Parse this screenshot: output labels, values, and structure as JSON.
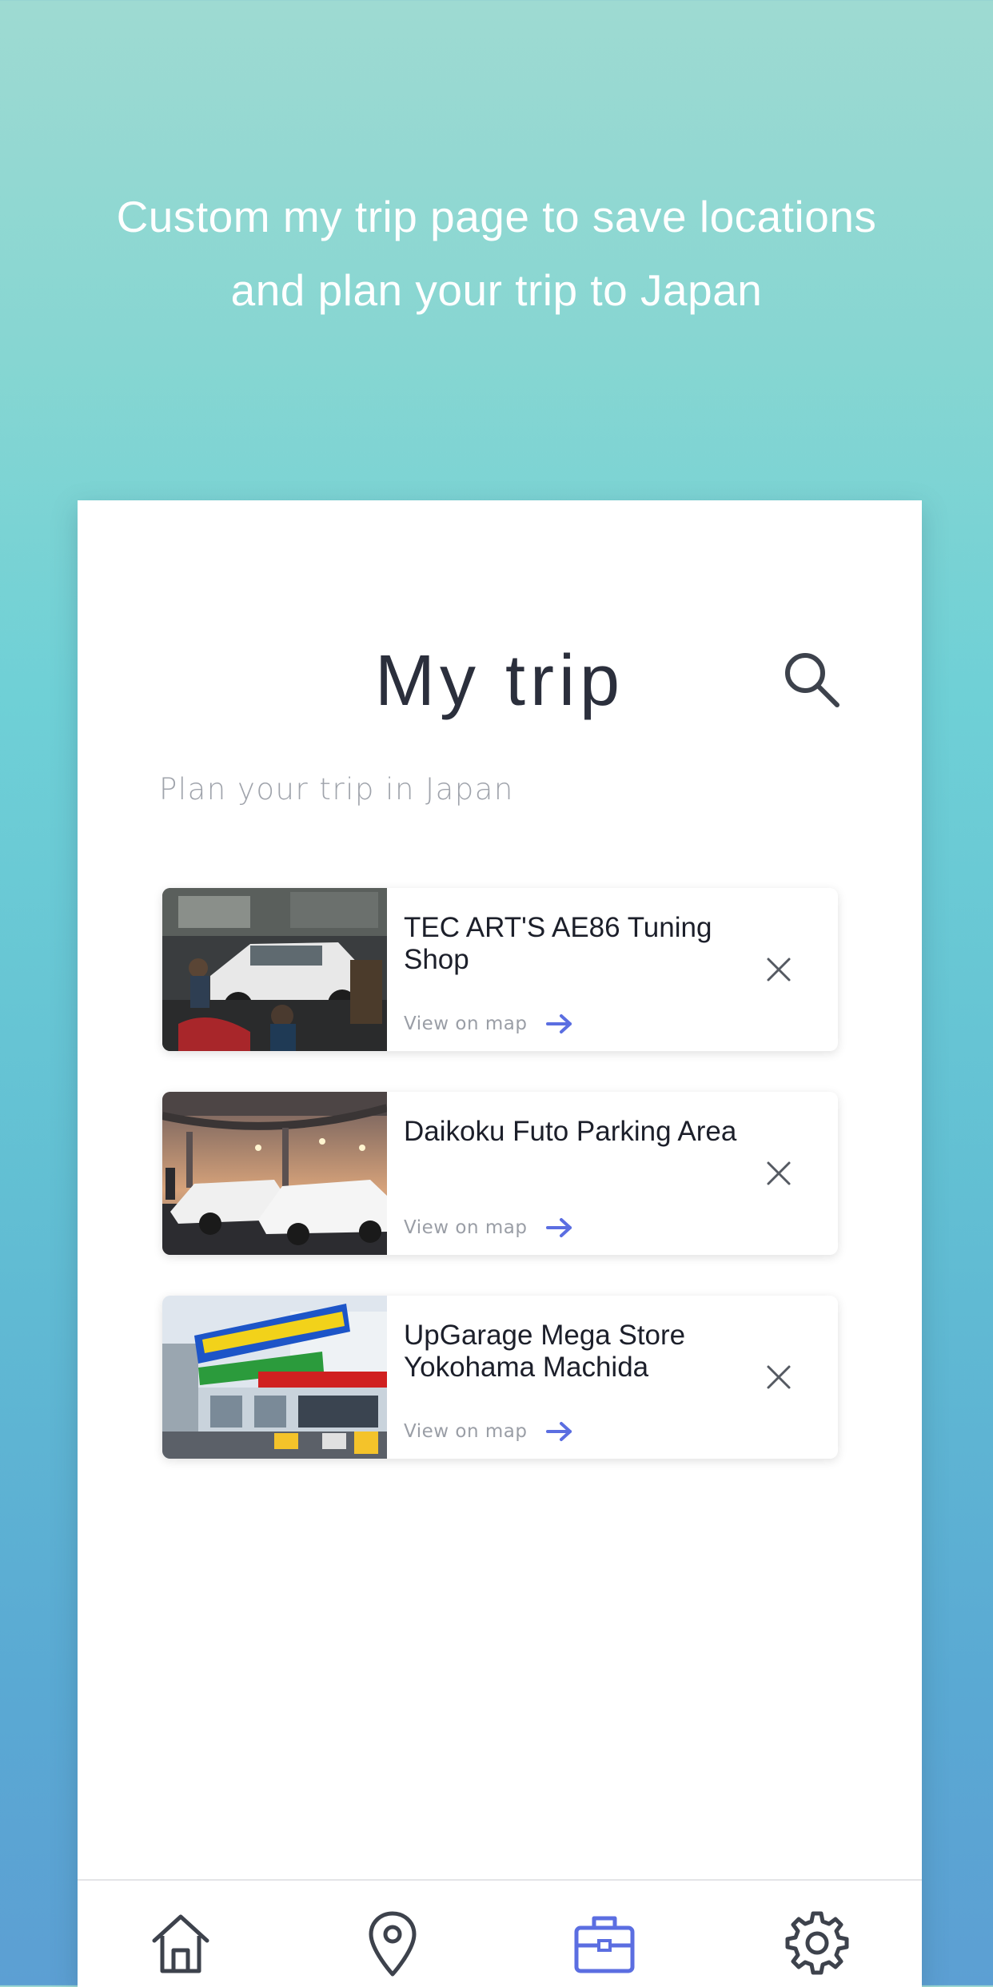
{
  "headline": {
    "line1": "Custom my trip page to save locations",
    "line2": "and plan your trip to Japan"
  },
  "screen": {
    "title": "My trip",
    "subtitle": "Plan your trip in Japan",
    "search_icon": "search-icon"
  },
  "trips": [
    {
      "name": "TEC ART'S AE86 Tuning Shop",
      "link": "View on map",
      "image": "tuning-shop-photo"
    },
    {
      "name": "Daikoku Futo Parking Area",
      "link": "View on map",
      "image": "parking-area-photo"
    },
    {
      "name": "UpGarage Mega Store Yokohama Machida",
      "link": "View on map",
      "image": "upgarage-store-photo"
    }
  ],
  "nav": {
    "items": [
      {
        "icon": "home-icon",
        "active": false
      },
      {
        "icon": "location-pin-icon",
        "active": false
      },
      {
        "icon": "briefcase-icon",
        "active": true
      },
      {
        "icon": "gear-icon",
        "active": false
      }
    ]
  },
  "colors": {
    "accent": "#5b6ee1",
    "title": "#2b2f3c",
    "icon_inactive": "#3d424c",
    "muted": "#9fa3ab"
  }
}
